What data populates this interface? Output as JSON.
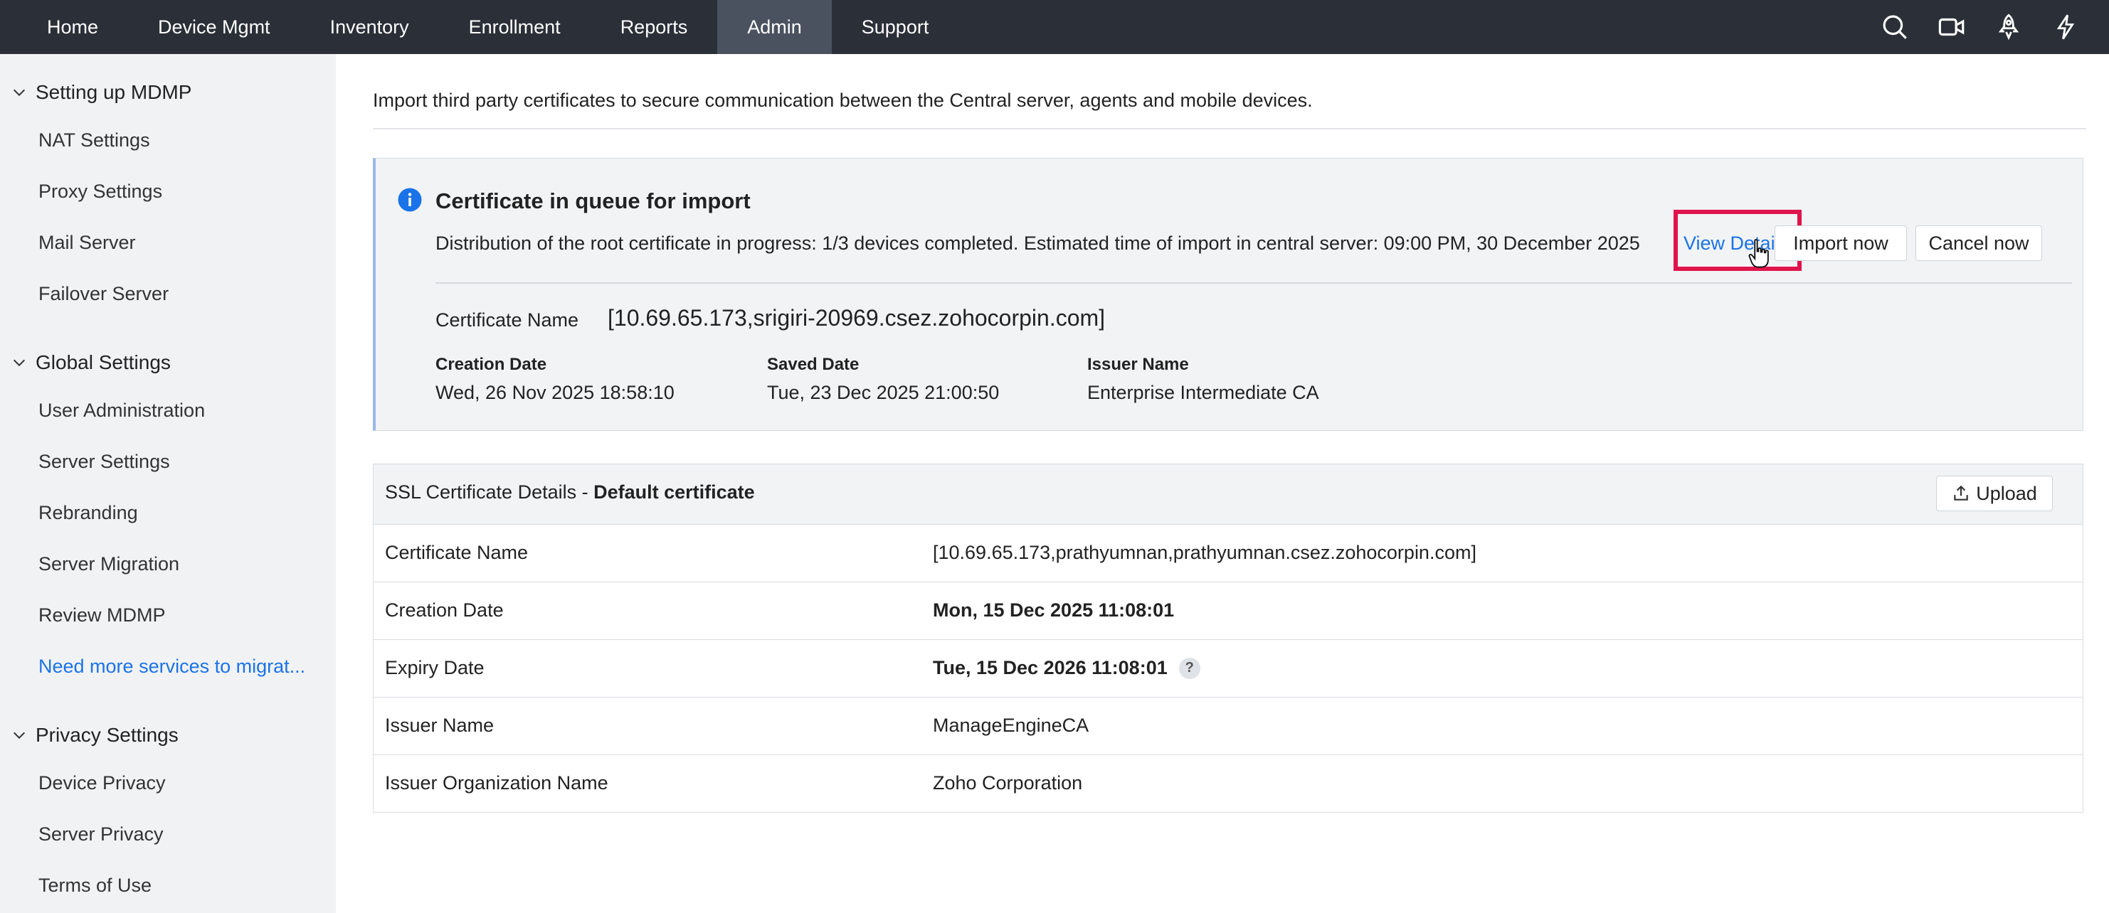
{
  "nav": {
    "tabs": [
      "Home",
      "Device Mgmt",
      "Inventory",
      "Enrollment",
      "Reports",
      "Admin",
      "Support"
    ],
    "active_tab": "Admin",
    "icons": [
      "search-icon",
      "video-icon",
      "rocket-icon",
      "lightning-icon"
    ]
  },
  "sidebar": {
    "groups": [
      {
        "title": "Setting up MDMP",
        "items": [
          "NAT Settings",
          "Proxy Settings",
          "Mail Server",
          "Failover Server"
        ]
      },
      {
        "title": "Global Settings",
        "items": [
          "User Administration",
          "Server Settings",
          "Rebranding",
          "Server Migration",
          "Review MDMP",
          "Need more services to migrat..."
        ]
      },
      {
        "title": "Privacy Settings",
        "items": [
          "Device Privacy",
          "Server Privacy",
          "Terms of Use"
        ]
      }
    ]
  },
  "main": {
    "intro": "Import third party certificates to secure communication between the Central server, agents and mobile devices.",
    "notice": {
      "title": "Certificate in queue for import",
      "description": "Distribution of the root certificate in progress: 1/3 devices completed. Estimated time of import in central server: 09:00 PM, 30 December 2025",
      "view_details": "View Details",
      "import_now": "Import now",
      "cancel_now": "Cancel now",
      "cert_name_label": "Certificate Name",
      "cert_name_value": "[10.69.65.173,srigiri-20969.csez.zohocorpin.com]",
      "creation_date_label": "Creation Date",
      "creation_date_value": "Wed, 26 Nov 2025 18:58:10",
      "saved_date_label": "Saved Date",
      "saved_date_value": "Tue, 23 Dec 2025 21:00:50",
      "issuer_name_label": "Issuer Name",
      "issuer_name_value": "Enterprise Intermediate CA"
    },
    "ssl": {
      "title_prefix": "SSL Certificate Details - ",
      "title_bold": "Default certificate",
      "upload": "Upload",
      "rows": [
        {
          "key": "Certificate Name",
          "value": "[10.69.65.173,prathyumnan,prathyumnan.csez.zohocorpin.com]"
        },
        {
          "key": "Creation Date",
          "value": "Mon, 15 Dec 2025 11:08:01"
        },
        {
          "key": "Expiry Date",
          "value": "Tue, 15 Dec 2026 11:08:01"
        },
        {
          "key": "Issuer Name",
          "value": "ManageEngineCA"
        },
        {
          "key": "Issuer Organization Name",
          "value": "Zoho Corporation"
        }
      ]
    }
  }
}
